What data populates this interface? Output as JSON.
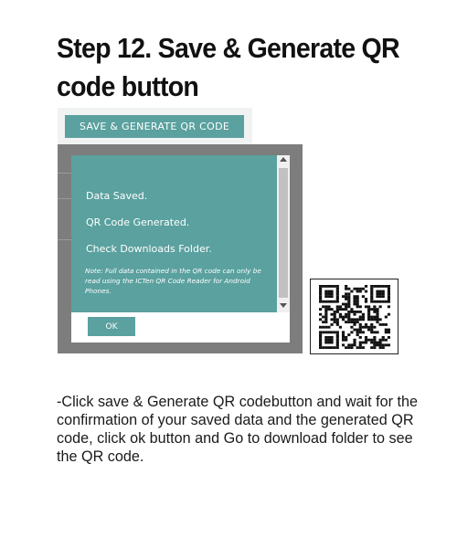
{
  "title": "Step 12. Save & Generate QR code button",
  "save_button": {
    "label": "SAVE & GENERATE QR CODE"
  },
  "dialog": {
    "messages": [
      "Data Saved.",
      "QR Code Generated.",
      "Check Downloads Folder."
    ],
    "note": "Note: Full data contained in the QR code can only be read using the ICTen QR Code Reader for Android Phones.",
    "ok_label": "OK"
  },
  "background_edge_char": "(",
  "instructions": "-Click save & Generate QR codebutton and wait for the confirmation of your saved data and the generated QR code, click ok button and  Go to download folder to see the QR code.",
  "colors": {
    "accent": "#5aa19f",
    "overlay": "#7d7d7d",
    "text": "#111111"
  },
  "icons": {
    "qr": "qr-code-icon",
    "scroll_up": "arrow-up-icon",
    "scroll_down": "arrow-down-icon"
  }
}
